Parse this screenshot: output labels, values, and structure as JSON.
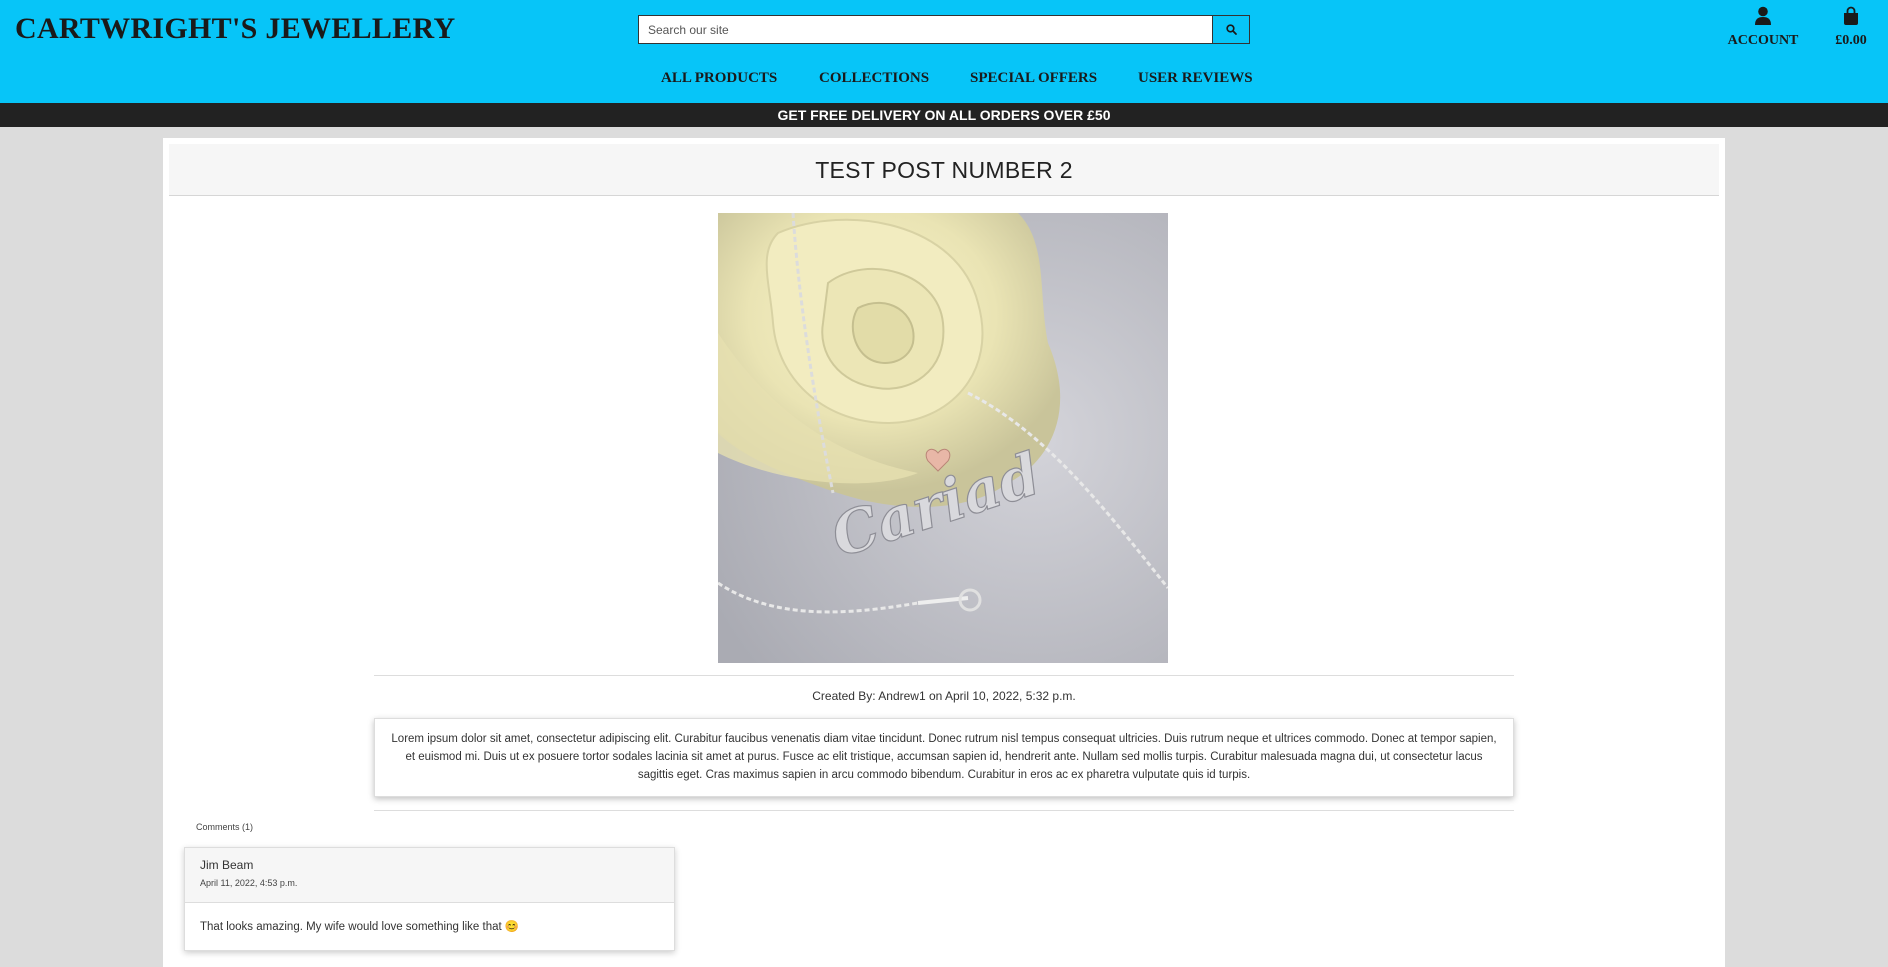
{
  "brand": {
    "logo": "CARTWRIGHT'S JEWELLERY",
    "accent": "#07c5f8"
  },
  "search": {
    "placeholder": "Search our site",
    "icon": "search-icon"
  },
  "account": {
    "label": "ACCOUNT",
    "icon": "user-icon"
  },
  "bag": {
    "total": "£0.00",
    "icon": "shopping-bag-icon"
  },
  "nav": {
    "items": [
      {
        "label": "ALL PRODUCTS"
      },
      {
        "label": "COLLECTIONS"
      },
      {
        "label": "SPECIAL OFFERS"
      },
      {
        "label": "USER REVIEWS"
      }
    ]
  },
  "banner": {
    "text": "GET FREE DELIVERY ON ALL ORDERS OVER £50"
  },
  "post": {
    "title": "TEST POST NUMBER 2",
    "image_alt": "Silver Cariad name necklace on a cream rose",
    "image_text": "Cariad",
    "created": "Created By: Andrew1 on April 10, 2022, 5:32 p.m.",
    "body": "Lorem ipsum dolor sit amet, consectetur adipiscing elit. Curabitur faucibus venenatis diam vitae tincidunt. Donec rutrum nisl tempus consequat ultricies. Duis rutrum neque et ultrices commodo. Donec at tempor sapien, et euismod mi. Duis ut ex posuere tortor sodales lacinia sit amet at purus. Fusce ac elit tristique, accumsan sapien id, hendrerit ante. Nullam sed mollis turpis. Curabitur malesuada magna dui, ut consectetur lacus sagittis eget. Cras maximus sapien in arcu commodo bibendum. Curabitur in eros ac ex pharetra vulputate quis id turpis."
  },
  "comments": {
    "count_label": "Comments (1)",
    "items": [
      {
        "author": "Jim Beam",
        "date": "April 11, 2022, 4:53 p.m.",
        "text": "That looks amazing. My wife would love something like that 😊"
      }
    ]
  }
}
